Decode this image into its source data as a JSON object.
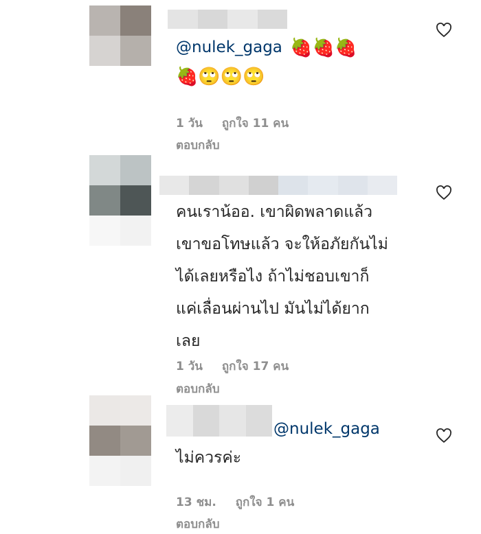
{
  "comments": [
    {
      "mention": "@nulek_gaga",
      "emoji_line1": "🍓🍓🍓",
      "emoji_line2": "🍓🙄🙄🙄",
      "time": "1 วัน",
      "likes": "ถูกใจ 11 คน",
      "reply": "ตอบกลับ"
    },
    {
      "lines": [
        "คนเราน้ออ. เขาผิดพลาดแล้ว",
        "เขาขอโทษแล้ว จะให้อภัยกันไม่",
        "ได้เลยหรือไง ถ้าไม่ชอบเขาก็",
        "แค่เลื่อนผ่านไป มันไม่ได้ยาก",
        "เลย"
      ],
      "time": "1 วัน",
      "likes": "ถูกใจ 17 คน",
      "reply": "ตอบกลับ"
    },
    {
      "mention": "@nulek_gaga",
      "text": "ไม่ควรค่ะ",
      "time": "13 ชม.",
      "likes": "ถูกใจ 1 คน",
      "reply": "ตอบกลับ"
    }
  ],
  "icons": {
    "like": "heart-outline-icon",
    "avatar": "pixelated-avatar"
  },
  "colors": {
    "text": "#262626",
    "muted": "#8e8e8e",
    "mention": "#00376b"
  }
}
